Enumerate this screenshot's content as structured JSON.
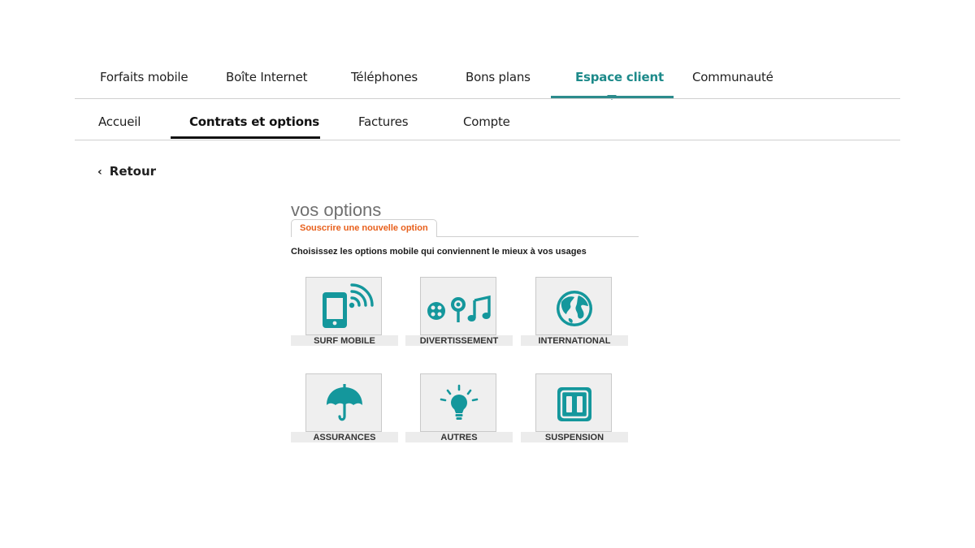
{
  "main_nav": {
    "items": [
      {
        "label": "Forfaits mobile"
      },
      {
        "label": "Boîte Internet"
      },
      {
        "label": "Téléphones"
      },
      {
        "label": "Bons plans"
      },
      {
        "label": "Espace client",
        "active": true
      },
      {
        "label": "Communauté"
      }
    ]
  },
  "sub_nav": {
    "items": [
      {
        "label": "Accueil"
      },
      {
        "label": "Contrats et options",
        "active": true
      },
      {
        "label": "Factures"
      },
      {
        "label": "Compte"
      }
    ]
  },
  "back": {
    "label": "Retour",
    "icon": "chevron-left-icon"
  },
  "options": {
    "title": "vos options",
    "tab_label": "Souscrire une nouvelle option",
    "intro": "Choisissez les options mobile qui conviennent le mieux à vos usages",
    "tiles": [
      {
        "label": "SURF MOBILE",
        "icon": "phone-signal-icon"
      },
      {
        "label": "DIVERTISSEMENT",
        "icon": "entertainment-icon"
      },
      {
        "label": "INTERNATIONAL",
        "icon": "globe-icon"
      },
      {
        "label": "ASSURANCES",
        "icon": "umbrella-icon"
      },
      {
        "label": "AUTRES",
        "icon": "lightbulb-icon"
      },
      {
        "label": "SUSPENSION",
        "icon": "pause-icon"
      }
    ]
  },
  "colors": {
    "accent": "#1d8a8a",
    "icon": "#14979c",
    "tab_text": "#e8601c"
  }
}
